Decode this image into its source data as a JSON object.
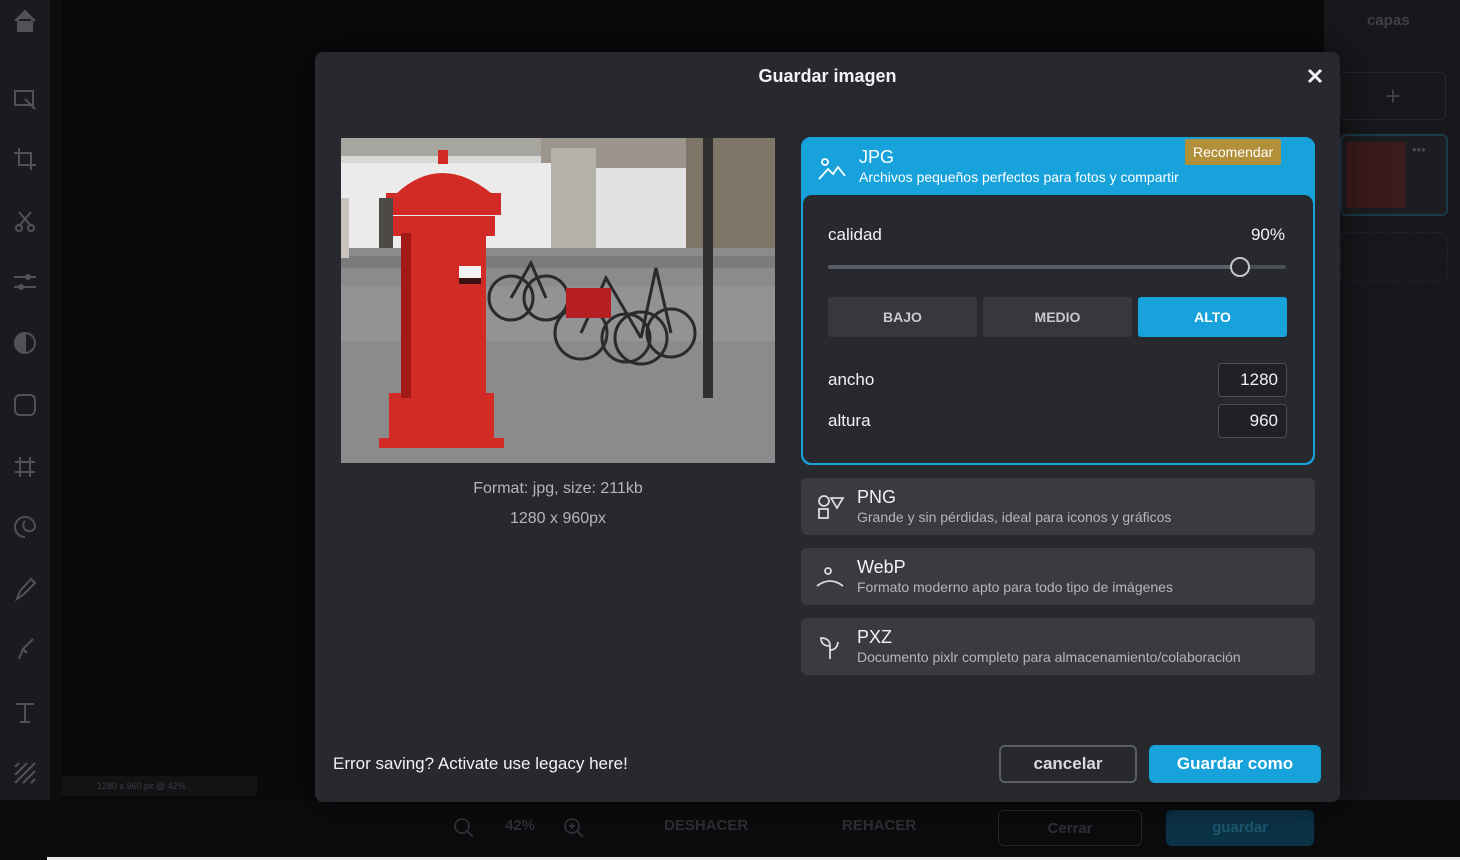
{
  "editor": {
    "layers_title": "capas",
    "layers_add": "+",
    "layer_menu": "•••",
    "canvas_info": "1280 x 960 px @ 42%",
    "zoom_value": "42%",
    "undo_label": "DESHACER",
    "redo_label": "REHACER",
    "close_label": "Cerrar",
    "save_label": "guardar"
  },
  "dialog": {
    "title": "Guardar imagen",
    "preview": {
      "format_info": "Format: jpg, size: 211kb",
      "dimensions_info": "1280 x 960px"
    },
    "formats": [
      {
        "name": "JPG",
        "description": "Archivos pequeños perfectos para fotos y compartir",
        "badge": "Recomendar",
        "icon": "image-mountain-icon",
        "selected": true
      },
      {
        "name": "PNG",
        "description": "Grande y sin pérdidas, ideal para iconos y gráficos",
        "icon": "shapes-icon"
      },
      {
        "name": "WebP",
        "description": "Formato moderno apto para todo tipo de imágenes",
        "icon": "horizon-icon"
      },
      {
        "name": "PXZ",
        "description": "Documento pixlr completo para almacenamiento/colaboración",
        "icon": "sprout-icon"
      }
    ],
    "quality": {
      "label": "calidad",
      "value_text": "90%",
      "value": 0.9,
      "presets": [
        "BAJO",
        "MEDIO",
        "ALTO"
      ],
      "active_preset": "ALTO"
    },
    "width": {
      "label": "ancho",
      "value": "1280"
    },
    "height": {
      "label": "altura",
      "value": "960"
    },
    "legacy_text": "Error saving? Activate use legacy here!",
    "cancel_label": "cancelar",
    "save_as_label": "Guardar como"
  },
  "colors": {
    "accent": "#17a2dc",
    "badge": "#b2903a",
    "modal_bg": "#27292e",
    "card_bg": "#393b41"
  }
}
